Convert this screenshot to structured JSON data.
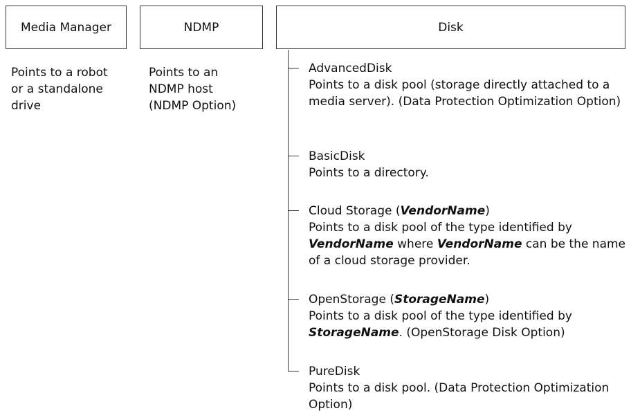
{
  "boxes": {
    "media_manager": "Media Manager",
    "ndmp": "NDMP",
    "disk": "Disk"
  },
  "descriptions": {
    "media_manager": "Points to a robot\nor a standalone\ndrive",
    "ndmp": "Points to an\nNDMP host\n(NDMP Option)"
  },
  "disk_types": [
    {
      "title": "AdvancedDisk",
      "description": "Points to a disk pool (storage directly attached to a media server). (Data Protection Optimization Option)"
    },
    {
      "title": "BasicDisk",
      "description": "Points to a directory."
    },
    {
      "title_prefix": "Cloud Storage (",
      "title_emphasis": "VendorName",
      "title_suffix": ")",
      "description_1": "Points to a disk pool of the type identified by ",
      "description_em_1": "VendorName",
      "description_2": " where ",
      "description_em_2": "VendorName",
      "description_3": " can be the name of a cloud storage provider."
    },
    {
      "title_prefix": "OpenStorage (",
      "title_emphasis": "StorageName",
      "title_suffix": ")",
      "description_1": "Points to a disk pool of the type identified by ",
      "description_em_1": "StorageName",
      "description_2": ".  (OpenStorage Disk Option)"
    },
    {
      "title": "PureDisk",
      "description": "Points to a disk pool. (Data Protection Optimization Option)"
    }
  ]
}
